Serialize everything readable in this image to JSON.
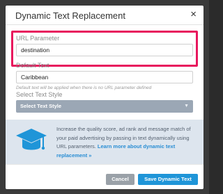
{
  "dialog": {
    "title": "Dynamic Text Replacement",
    "close_icon": "×"
  },
  "url_parameter": {
    "label": "URL Parameter",
    "value": "destination"
  },
  "default_text": {
    "label": "Default Text",
    "value": "Caribbean",
    "help": "Default text will be applied when there is no URL parameter defined"
  },
  "text_style": {
    "label": "Select Text Style",
    "selected": "Select Text Style",
    "arrow_icon": "▼"
  },
  "info": {
    "icon": "graduation-cap-icon",
    "text": "Increase the quality score, ad rank and message match of your paid advertising by passing in text dynamically using URL parameters.",
    "link": "Learn more about dynamic text replacement »"
  },
  "buttons": {
    "cancel": "Cancel",
    "save": "Save Dynamic Text"
  },
  "colors": {
    "highlight": "#e8175d",
    "primary": "#1f95d8",
    "info_bg": "#dde5ee"
  }
}
